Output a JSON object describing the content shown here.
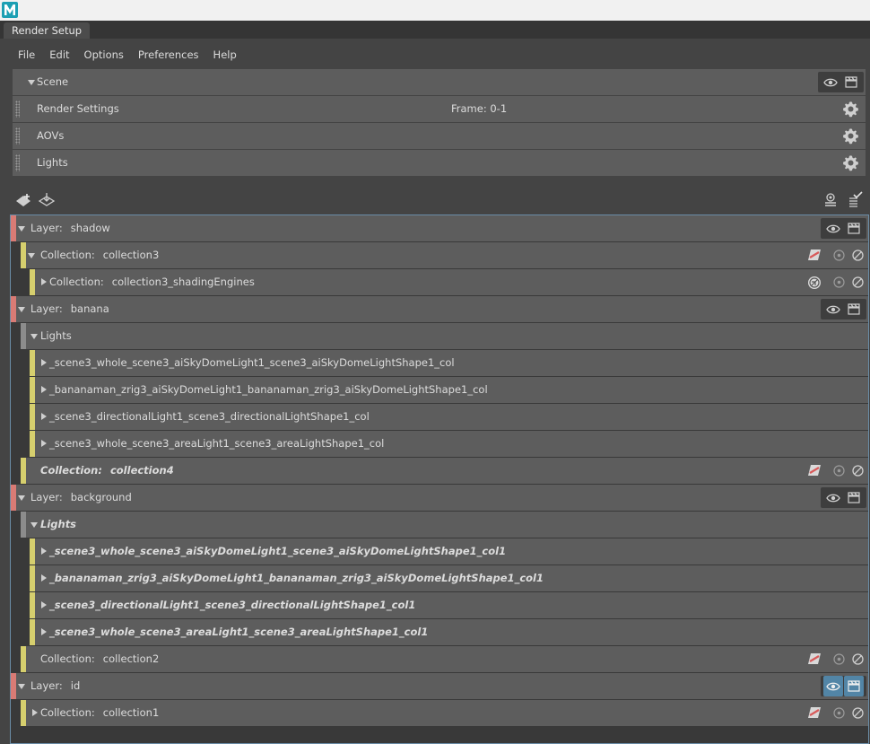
{
  "window": {
    "tab": "Render Setup"
  },
  "menu": [
    "File",
    "Edit",
    "Options",
    "Preferences",
    "Help"
  ],
  "scene": {
    "label": "Scene",
    "rows": [
      {
        "label": "Render Settings",
        "info": "Frame: 0-1"
      },
      {
        "label": "AOVs",
        "info": ""
      },
      {
        "label": "Lights",
        "info": ""
      }
    ]
  },
  "tree": [
    {
      "kind": "layer",
      "name": "shadow",
      "prefix": "Layer:",
      "expanded": true
    },
    {
      "kind": "collection",
      "name": "collection3",
      "prefix": "Collection:",
      "expanded": true,
      "override_icon": "override-icon"
    },
    {
      "kind": "collection",
      "name": "collection3_shadingEngines",
      "prefix": "Collection:",
      "expanded": false,
      "override_icon": "shading-override-icon"
    },
    {
      "kind": "layer",
      "name": "banana",
      "prefix": "Layer:",
      "expanded": true
    },
    {
      "kind": "group",
      "name": "Lights",
      "expanded": true
    },
    {
      "kind": "item",
      "name": "_scene3_whole_scene3_aiSkyDomeLight1_scene3_aiSkyDomeLightShape1_col"
    },
    {
      "kind": "item",
      "name": "_bananaman_zrig3_aiSkyDomeLight1_bananaman_zrig3_aiSkyDomeLightShape1_col"
    },
    {
      "kind": "item",
      "name": "_scene3_directionalLight1_scene3_directionalLightShape1_col"
    },
    {
      "kind": "item",
      "name": "_scene3_whole_scene3_areaLight1_scene3_areaLightShape1_col"
    },
    {
      "kind": "collection",
      "name": "collection4",
      "prefix": "Collection:",
      "bold": true,
      "override_icon": "override-icon"
    },
    {
      "kind": "layer",
      "name": "background",
      "prefix": "Layer:",
      "expanded": true
    },
    {
      "kind": "group",
      "name": "Lights",
      "expanded": true,
      "bold": true
    },
    {
      "kind": "item",
      "name": "_scene3_whole_scene3_aiSkyDomeLight1_scene3_aiSkyDomeLightShape1_col1",
      "bold": true
    },
    {
      "kind": "item",
      "name": "_bananaman_zrig3_aiSkyDomeLight1_bananaman_zrig3_aiSkyDomeLightShape1_col1",
      "bold": true
    },
    {
      "kind": "item",
      "name": "_scene3_directionalLight1_scene3_directionalLightShape1_col1",
      "bold": true
    },
    {
      "kind": "item",
      "name": "_scene3_whole_scene3_areaLight1_scene3_areaLightShape1_col1",
      "bold": true
    },
    {
      "kind": "collection",
      "name": "collection2",
      "prefix": "Collection:",
      "override_icon": "override-icon"
    },
    {
      "kind": "layer",
      "name": "id",
      "prefix": "Layer:",
      "expanded": true,
      "visible_active": true,
      "renderable_active": true
    },
    {
      "kind": "collection",
      "name": "collection1",
      "prefix": "Collection:",
      "expanded": false,
      "override_icon": "override-icon"
    }
  ],
  "colors": {
    "layer": "#d97b75",
    "collection": "#d6cf6e",
    "group": "#8c8c8c",
    "active": "#5285a6",
    "row": "#5d5d5d",
    "panel": "#444444"
  }
}
